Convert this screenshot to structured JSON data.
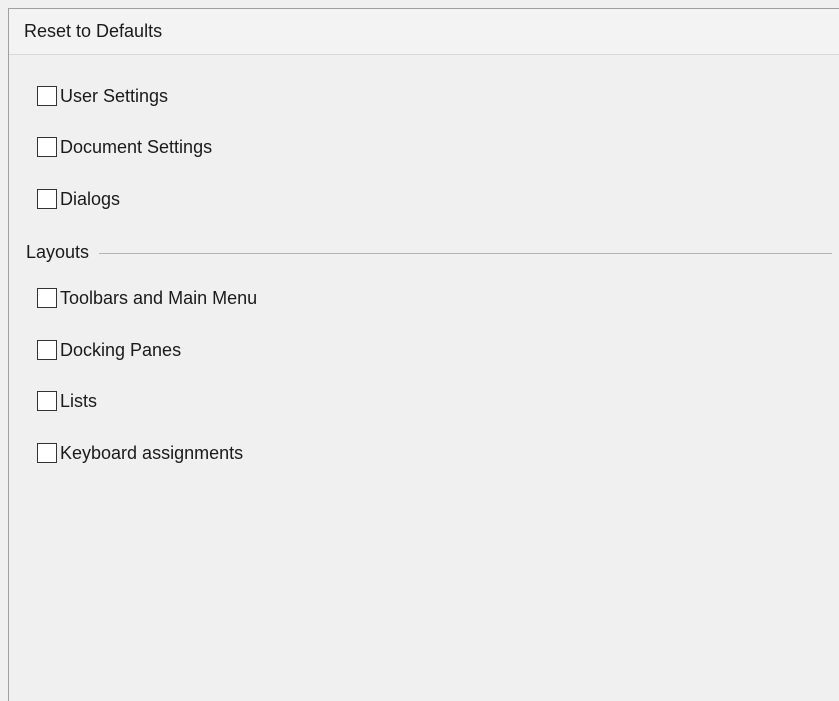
{
  "panel": {
    "title": "Reset to Defaults"
  },
  "items": [
    {
      "label": "User Settings",
      "checked": false
    },
    {
      "label": "Document Settings",
      "checked": false
    },
    {
      "label": "Dialogs",
      "checked": false
    }
  ],
  "layouts_section": {
    "label": "Layouts",
    "items": [
      {
        "label": "Toolbars and Main Menu",
        "checked": false
      },
      {
        "label": "Docking Panes",
        "checked": false
      },
      {
        "label": "Lists",
        "checked": false
      },
      {
        "label": "Keyboard assignments",
        "checked": false
      }
    ]
  }
}
